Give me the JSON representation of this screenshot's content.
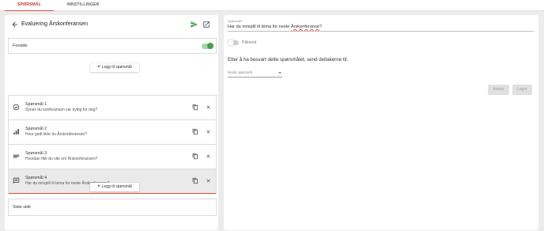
{
  "tabs": [
    {
      "label": "SPØRSMÅL",
      "active": true
    },
    {
      "label": "INNSTILLINGER",
      "active": false
    }
  ],
  "survey": {
    "title": "Evaluering Årskonferansen",
    "back_icon": "arrow-left-icon",
    "send_icon": "send-icon",
    "open_icon": "open-in-new-icon"
  },
  "forside": {
    "label": "Forside",
    "toggle_on": true
  },
  "add_question_label": "Legg til spørsmål",
  "questions": [
    {
      "title": "Spørsmål 1",
      "text": "Synes du konferansen var nyttig for deg?",
      "icon": "check-circle-icon",
      "selected": false
    },
    {
      "title": "Spørsmål 2",
      "text": "Hvor godt likte du Årskonferansen?",
      "icon": "bar-chart-icon",
      "selected": false
    },
    {
      "title": "Spørsmål 3",
      "text": "Hvordan fikk du vite om Årskonferansen?",
      "icon": "short-text-icon",
      "selected": false
    },
    {
      "title": "Spørsmål 4",
      "text": "Har du innspill til tema for neste Årskonferanse?",
      "icon": "comment-icon",
      "selected": true
    }
  ],
  "siste_side": {
    "label": "Siste side"
  },
  "editor": {
    "field_label": "Spørsmål *",
    "field_value_prefix": "Har du innspill til tema for neste ",
    "field_value_word": "Årskonferanse",
    "field_value_suffix": "?",
    "required_label": "Påkrevd",
    "required_on": false,
    "after_answer_text": "Etter å ha besvart dette spørsmålet, send deltakerne til:",
    "next_select_value": "Neste spørsmål",
    "cancel_label": "Avbryt",
    "save_label": "Lagre"
  },
  "colors": {
    "accent_red": "#e74c3c",
    "toggle_green": "#43a047",
    "send_green": "#43a047"
  }
}
